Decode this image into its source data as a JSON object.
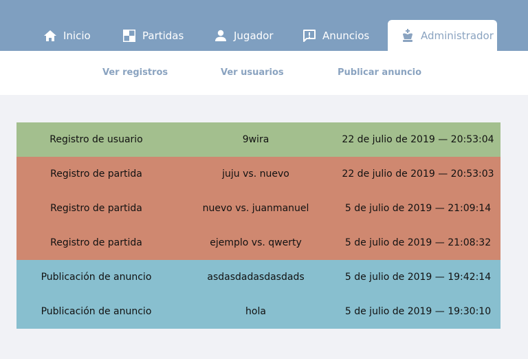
{
  "colors": {
    "header_bg": "#7f9fc0",
    "accent": "#8aa3c0",
    "row_usuario": "#a3bf8e",
    "row_partida": "#cf8870",
    "row_anuncio": "#88bfcf",
    "page_bg": "#f1f2f6"
  },
  "tabs": [
    {
      "label": "Inicio",
      "icon": "home-icon"
    },
    {
      "label": "Partidas",
      "icon": "board-icon"
    },
    {
      "label": "Jugador",
      "icon": "user-icon"
    },
    {
      "label": "Anuncios",
      "icon": "announcement-icon"
    },
    {
      "label": "Administrador",
      "icon": "king-icon",
      "active": true
    }
  ],
  "subnav": {
    "ver_registros": "Ver registros",
    "ver_usuarios": "Ver usuarios",
    "publicar_anuncio": "Publicar anuncio"
  },
  "logs": [
    {
      "type": "Registro de usuario",
      "subject": "9wira",
      "date": "22 de julio de 2019 — 20:53:04"
    },
    {
      "type": "Registro de partida",
      "subject": "juju vs. nuevo",
      "date": "22 de julio de 2019 — 20:53:03"
    },
    {
      "type": "Registro de partida",
      "subject": "nuevo vs. juanmanuel",
      "date": "5 de julio de 2019 — 21:09:14"
    },
    {
      "type": "Registro de partida",
      "subject": "ejemplo vs. qwerty",
      "date": "5 de julio de 2019 — 21:08:32"
    },
    {
      "type": "Publicación de anuncio",
      "subject": "asdasdadasdasdads",
      "date": "5 de julio de 2019 — 19:42:14"
    },
    {
      "type": "Publicación de anuncio",
      "subject": "hola",
      "date": "5 de julio de 2019 — 19:30:10"
    }
  ]
}
